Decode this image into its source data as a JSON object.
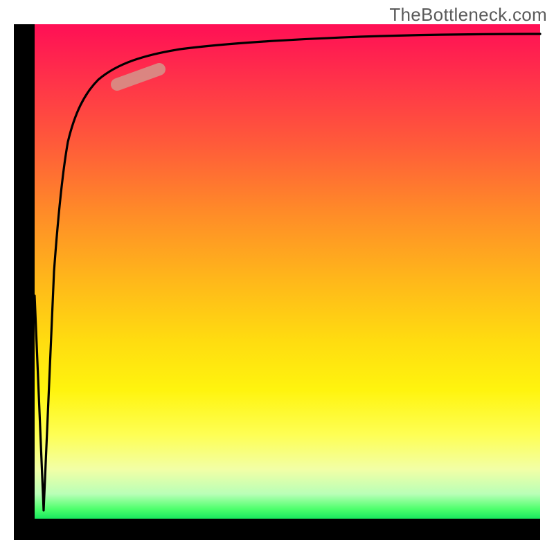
{
  "watermark": "TheBottleneck.com",
  "chart_data": {
    "type": "line",
    "title": "",
    "xlabel": "",
    "ylabel": "",
    "xlim": [
      0,
      100
    ],
    "ylim": [
      0,
      100
    ],
    "grid": false,
    "series": [
      {
        "name": "main-curve",
        "x": [
          0,
          2,
          3,
          4,
          5,
          6,
          8,
          10,
          12,
          15,
          18,
          22,
          28,
          35,
          45,
          60,
          80,
          100
        ],
        "values": [
          45,
          5,
          30,
          50,
          62,
          70,
          78,
          83,
          86,
          89,
          91,
          93,
          94,
          95,
          96,
          97,
          97.5,
          98
        ]
      }
    ],
    "annotations": [
      {
        "name": "highlight-segment",
        "x_start": 18,
        "x_end": 26,
        "note": "salmon highlight band near top-left of curve"
      }
    ]
  },
  "colors": {
    "frame": "#000000",
    "curve": "#000000",
    "highlight": "#d88d85",
    "gradient_top": "#ff0f55",
    "gradient_bottom": "#18e85e",
    "watermark_text": "#5a5a5a"
  }
}
